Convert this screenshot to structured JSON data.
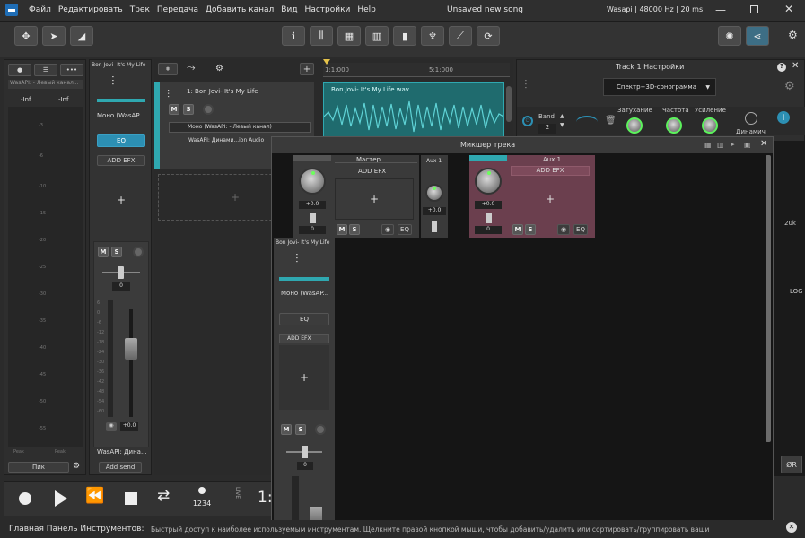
{
  "app": {
    "menu": [
      "Файл",
      "Редактировать",
      "Трек",
      "Передача",
      "Добавить канал",
      "Вид",
      "Настройки",
      "Help"
    ],
    "title": "Unsaved new song",
    "audio_info": "Wasapi | 48000 Hz | 20 ms"
  },
  "meter": {
    "left_label": "-Inf",
    "right_label": "-Inf",
    "device": "WasAPI: - Левый канал...",
    "ticks": [
      "-3",
      "-6",
      "-10",
      "-15",
      "-20",
      "-25",
      "-30",
      "-35",
      "-40",
      "-45",
      "-50",
      "-55"
    ],
    "bottom_left": "Peak",
    "bottom_right": "Peak",
    "peak_button": "Пик"
  },
  "channel_strip": {
    "name": "Bon Jovi- It's My Life",
    "mode": "Моно (WasAP...",
    "eq": "EQ",
    "add_efx": "ADD EFX",
    "gain": "0",
    "pan": "+0.0",
    "output": "WasAPI: Дина...",
    "add_send": "Add send",
    "fader_ticks": [
      "6",
      "0",
      "-6",
      "-12",
      "-18",
      "-24",
      "-30",
      "-36",
      "-42",
      "-48",
      "-54",
      "-60"
    ]
  },
  "track": {
    "title": "1: Bon Jovi- It's My Life",
    "input": "Моно (WasAPI: - Левый канал)",
    "output": "WasAPI: Динами...ion Audio",
    "clip_name": "Bon Jovi- It's My Life.wav",
    "ruler_1": "1:1:000",
    "ruler_2": "5:1:000"
  },
  "settings_panel": {
    "title": "Track 1 Настройки",
    "view_mode": "Спектр+3D-сонограмма",
    "band_label": "Band",
    "band_value": "2",
    "decay": "Затухание",
    "freq": "Частота",
    "gain": "Усиление",
    "dynamic": "Динамич",
    "label_20k": "20k",
    "label_log": "LOG",
    "btn_r": "ØR"
  },
  "mixer": {
    "title": "Микшер трека",
    "master": {
      "name": "Мастер",
      "add_efx": "ADD EFX",
      "pan": "+0.0",
      "gain": "0",
      "eq": "EQ"
    },
    "aux_small": {
      "name": "Aux 1",
      "pan": "+0.0"
    },
    "aux": {
      "name": "Aux 1",
      "add_efx": "ADD EFX",
      "pan": "+0.0",
      "gain": "0",
      "eq": "EQ"
    },
    "track_strip": {
      "name": "Bon Jovi- It's My Life",
      "mode": "Моно (WasAP...",
      "eq": "EQ",
      "add_efx": "ADD EFX",
      "gain": "0"
    }
  },
  "transport": {
    "counter": "1234",
    "live": "LIVE",
    "position": "1:"
  },
  "status": {
    "label": "Главная Панель Инструментов:",
    "text": "Быстрый доступ к наиболее используемым инструментам. Щелкните правой кнопкой мыши, чтобы добавить/удалить или сортировать/группировать ваши"
  },
  "colors": {
    "accent": "#2fa8b0",
    "aux_bg": "#6b3f4e",
    "selected": "#2c8fb3",
    "meter_green": "#5cf25c"
  }
}
